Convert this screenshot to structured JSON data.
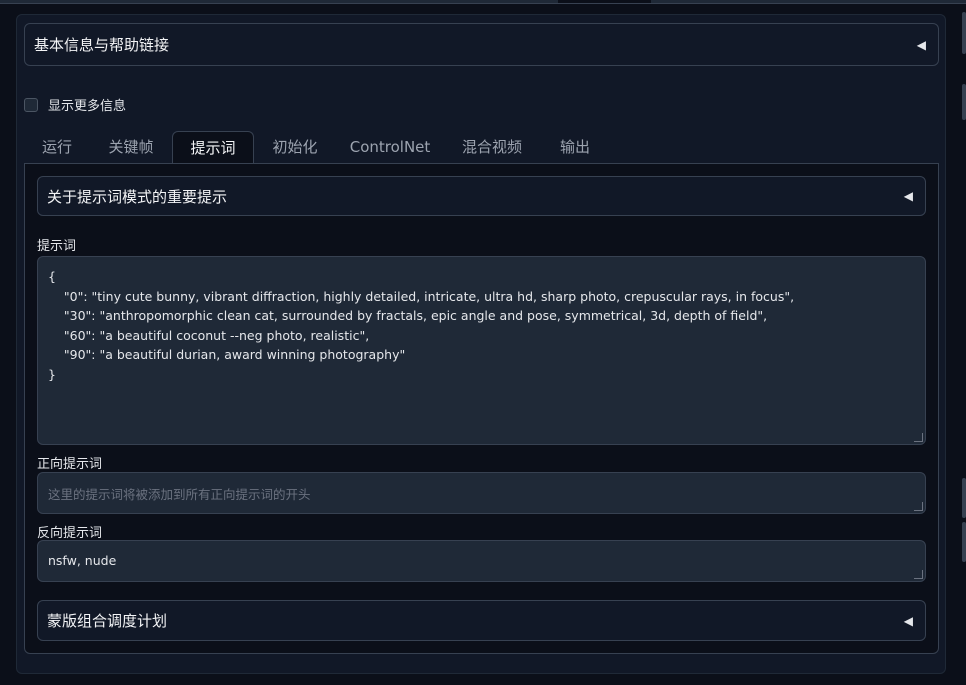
{
  "info_accordion": {
    "title": "基本信息与帮助链接",
    "arrow": "◀"
  },
  "show_more_info": {
    "label": "显示更多信息",
    "checked": false
  },
  "tabs": [
    {
      "label": "运行",
      "active": false
    },
    {
      "label": "关键帧",
      "active": false
    },
    {
      "label": "提示词",
      "active": true
    },
    {
      "label": "初始化",
      "active": false
    },
    {
      "label": "ControlNet",
      "active": false
    },
    {
      "label": "混合视频",
      "active": false
    },
    {
      "label": "输出",
      "active": false
    }
  ],
  "prompt_mode_accordion": {
    "title": "关于提示词模式的重要提示",
    "arrow": "◀"
  },
  "prompts": {
    "label": "提示词",
    "lines": [
      "{",
      "    \"0\": \"tiny cute bunny, vibrant diffraction, highly detailed, intricate, ultra hd, sharp photo, crepuscular rays, in focus\",",
      "    \"30\": \"anthropomorphic clean cat, surrounded by fractals, epic angle and pose, symmetrical, 3d, depth of field\",",
      "    \"60\": \"a beautiful coconut --neg photo, realistic\",",
      "    \"90\": \"a beautiful durian, award winning photography\"",
      "}"
    ]
  },
  "positive_prompt": {
    "label": "正向提示词",
    "value": "",
    "placeholder": "这里的提示词将被添加到所有正向提示词的开头"
  },
  "negative_prompt": {
    "label": "反向提示词",
    "value": "nsfw, nude"
  },
  "mask_schedule_accordion": {
    "title": "蒙版组合调度计划",
    "arrow": "◀"
  }
}
